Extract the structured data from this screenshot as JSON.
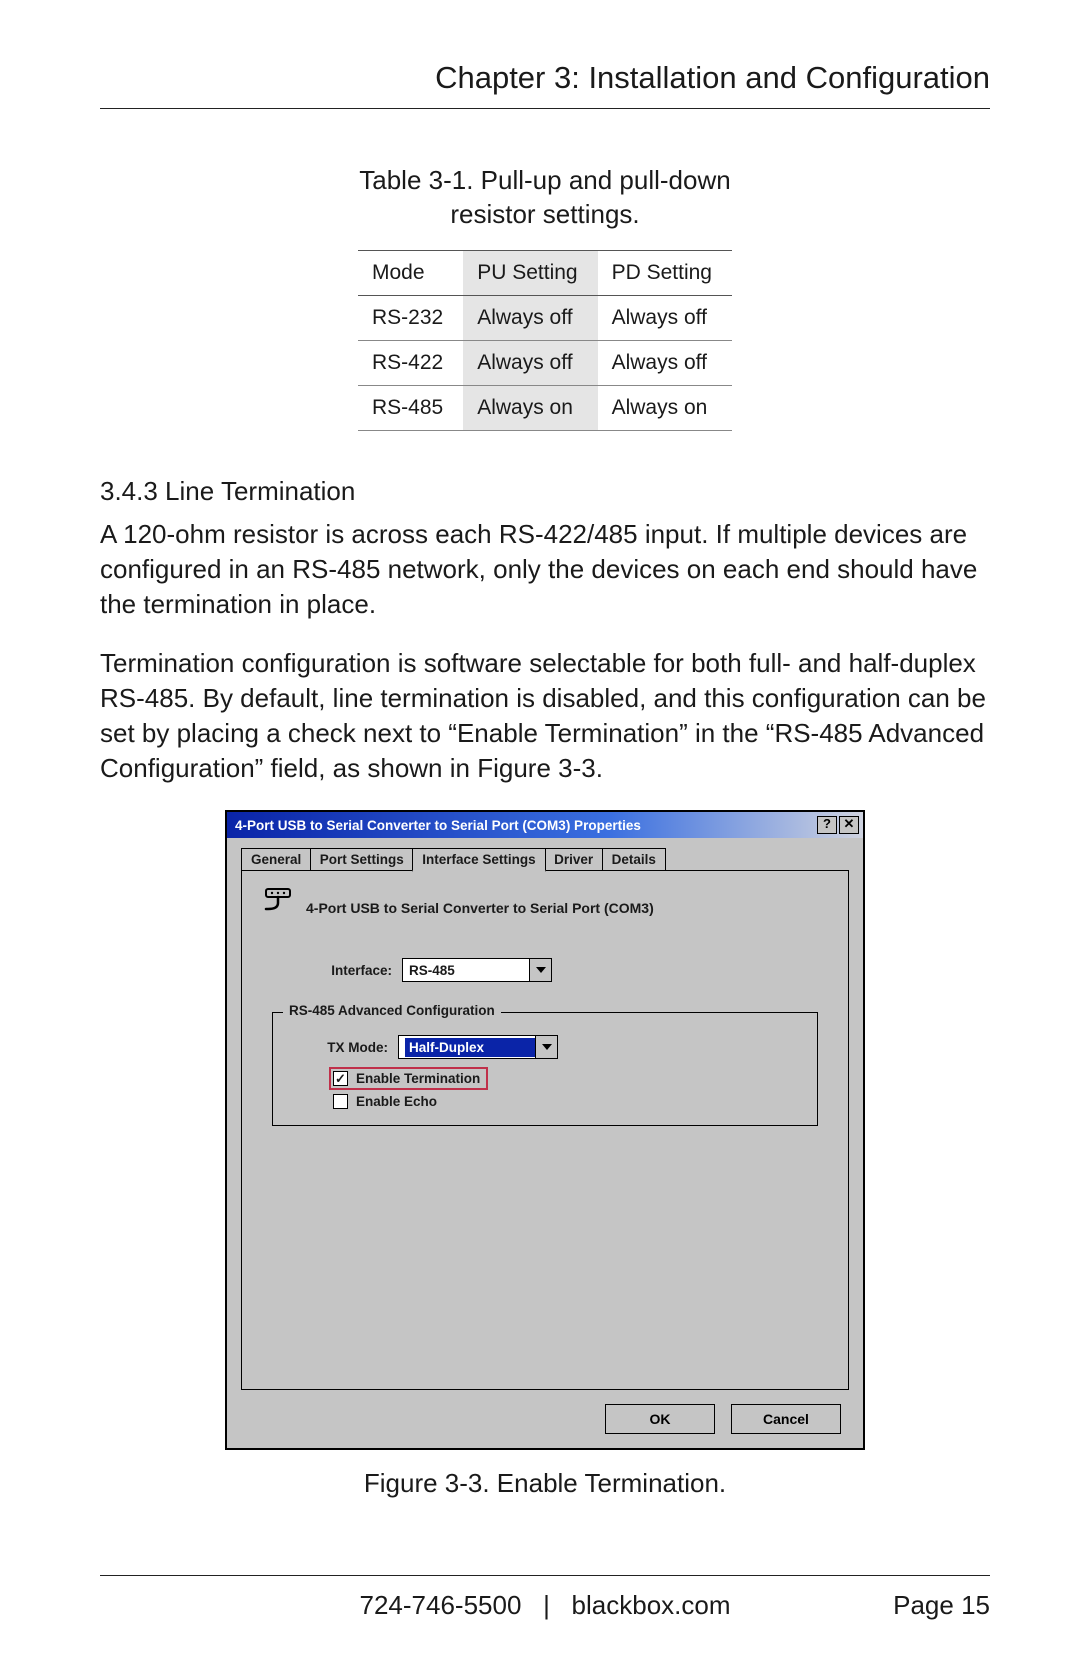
{
  "chapter_title": "Chapter 3: Installation and Configuration",
  "table_caption_l1": "Table 3-1. Pull-up and pull-down",
  "table_caption_l2": "resistor settings.",
  "resistor_table": {
    "headers": {
      "mode": "Mode",
      "pu": "PU Setting",
      "pd": "PD Setting"
    },
    "rows": [
      {
        "mode": "RS-232",
        "pu": "Always off",
        "pd": "Always off"
      },
      {
        "mode": "RS-422",
        "pu": "Always off",
        "pd": "Always off"
      },
      {
        "mode": "RS-485",
        "pu": "Always on",
        "pd": "Always on"
      }
    ]
  },
  "section_heading": "3.4.3 Line Termination",
  "para1": "A 120-ohm resistor is across each RS-422/485 input. If multiple devices are configured in an RS-485 network, only the devices on each end should have the termination in place.",
  "para2": "Termination configuration is software selectable for both full- and half-duplex RS-485. By default, line termination is disabled, and this configuration can be set by placing a check next to “Enable Termination” in the “RS-485 Advanced Configuration” field, as shown in Figure 3-3.",
  "dialog": {
    "title": "4-Port USB to Serial Converter to Serial Port (COM3) Properties",
    "help_btn": "?",
    "close_btn": "✕",
    "tabs": [
      "General",
      "Port Settings",
      "Interface Settings",
      "Driver",
      "Details"
    ],
    "active_tab_index": 2,
    "device_label": "4-Port USB to Serial Converter to Serial Port (COM3)",
    "interface_label": "Interface:",
    "interface_value": "RS-485",
    "fieldset_legend": "RS-485 Advanced Configuration",
    "tx_mode_label": "TX Mode:",
    "tx_mode_value": "Half-Duplex",
    "enable_termination_label": "Enable Termination",
    "enable_termination_checked": true,
    "enable_echo_label": "Enable Echo",
    "enable_echo_checked": false,
    "ok_label": "OK",
    "cancel_label": "Cancel"
  },
  "figure_caption": "Figure 3-3. Enable Termination.",
  "footer": {
    "phone": "724-746-5500",
    "sep": "|",
    "site": "blackbox.com",
    "page": "Page 15"
  }
}
